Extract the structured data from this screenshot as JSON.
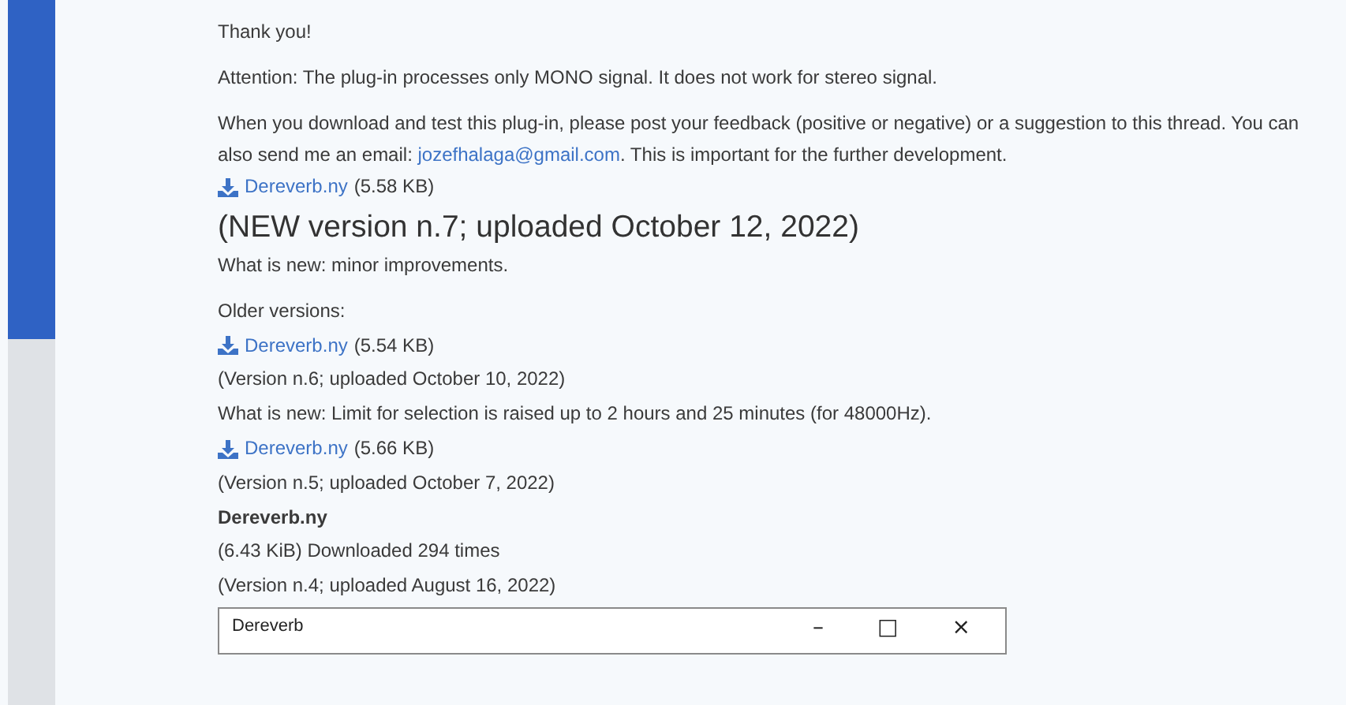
{
  "post": {
    "blocks": [
      {
        "kind": "paragraph",
        "text": "Thank you!"
      },
      {
        "kind": "paragraph",
        "text": "Attention: The plug-in processes only MONO signal. It does not work for stereo signal."
      },
      {
        "kind": "mail",
        "before": "When you download and test this plug-in, please post your feedback (positive or negative) or a suggestion to this thread. You can also send me an email: ",
        "link": "jozefhalaga@gmail.com",
        "after": ". This is important for the further development."
      },
      {
        "kind": "download",
        "link": "Dereverb.ny",
        "size": "(5.58 KB)"
      },
      {
        "kind": "heading",
        "text": "(NEW version n.7; uploaded October 12, 2022)"
      },
      {
        "kind": "paragraph",
        "text": "What is new: minor improvements."
      },
      {
        "kind": "line",
        "text": "Older versions:"
      },
      {
        "kind": "download",
        "link": "Dereverb.ny",
        "size": "(5.54 KB)"
      },
      {
        "kind": "line",
        "text": "(Version n.6; uploaded October 10, 2022)"
      },
      {
        "kind": "line",
        "text": "What is new: Limit for selection is raised up to 2 hours and 25 minutes (for 48000Hz)."
      },
      {
        "kind": "download",
        "link": "Dereverb.ny",
        "size": "(5.66 KB)"
      },
      {
        "kind": "line",
        "text": "(Version n.5; uploaded October 7, 2022)"
      },
      {
        "kind": "title",
        "text": "Dereverb.ny"
      },
      {
        "kind": "line",
        "text": "(6.43 KiB) Downloaded 294 times"
      },
      {
        "kind": "line",
        "text": "(Version n.4; uploaded August 16, 2022)"
      }
    ]
  },
  "dialog": {
    "title": "Dereverb",
    "controls": [
      "–",
      "□",
      "×"
    ]
  }
}
